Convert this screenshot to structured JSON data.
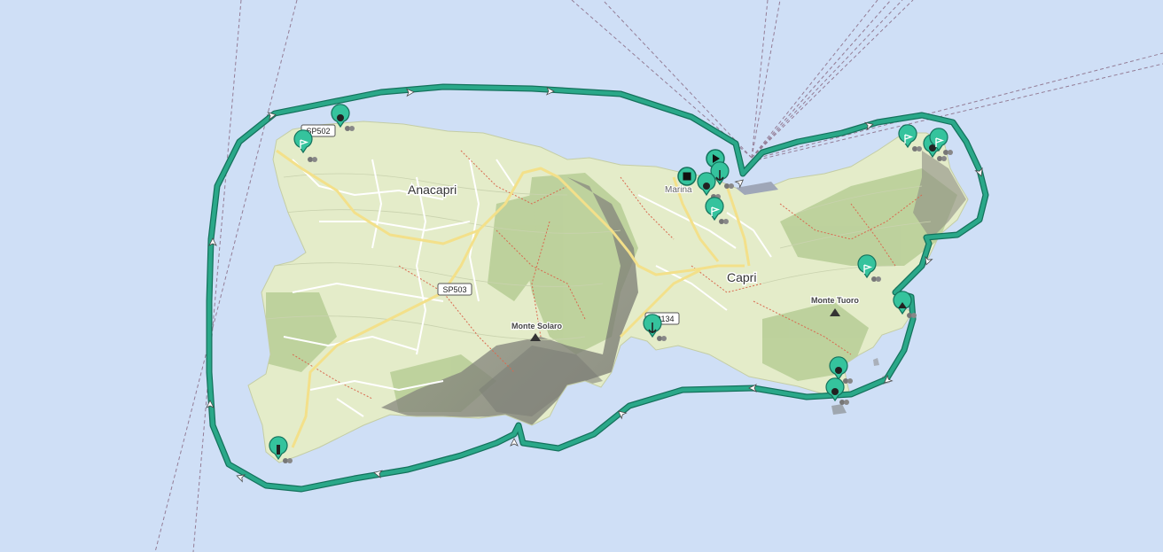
{
  "map": {
    "colors": {
      "sea": "#cfdff6",
      "land": "#e4ecc9",
      "forest": "#b9cf98",
      "relief": "#8e8e86",
      "route": "#2aa889",
      "route_dark": "#14725c",
      "road_major": "#f3e08a",
      "road_minor": "#ffffff",
      "trail": "#d9694f",
      "ferry": "#8a6d86",
      "marker": "#35c39d"
    },
    "place_labels": {
      "anacapri": "Anacapri",
      "capri": "Capri",
      "marina": "Marina",
      "monte_solaro": "Monte Solaro",
      "monte_tuoro": "Monte Tuoro"
    },
    "road_shields": {
      "sp502": "SP502",
      "sp503": "SP503",
      "sp134": "SP134"
    },
    "markers": {
      "start": "play",
      "end": "stop",
      "waypoints": [
        "flag",
        "flag",
        "flag",
        "flag",
        "flag",
        "swimmer",
        "anchor",
        "swimmer",
        "anchor",
        "cave",
        "swimmer",
        "diver",
        "diver",
        "diver",
        "lighthouse",
        "flag"
      ]
    },
    "route_direction": "clockwise"
  }
}
